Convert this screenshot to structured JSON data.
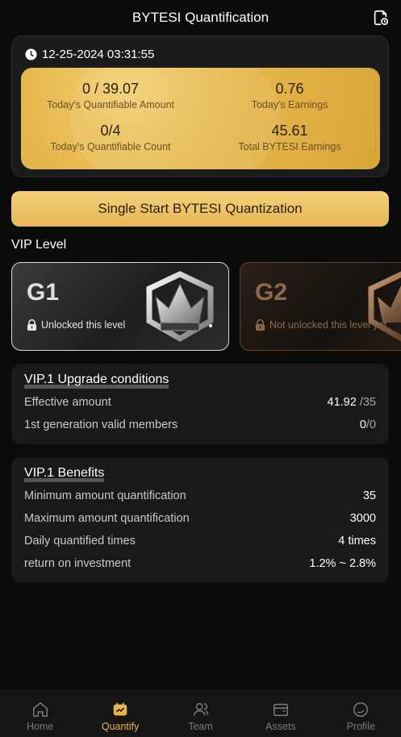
{
  "header": {
    "title": "BYTESI Quantification",
    "icon": "record-history-icon"
  },
  "summary": {
    "datetime": "12-25-2024 03:31:55",
    "quantifiable_amount": {
      "value": "0 / 39.07",
      "label": "Today's Quantifiable Amount"
    },
    "earnings": {
      "value": "0.76",
      "label": "Today's Earnings"
    },
    "quantifiable_count": {
      "value": "0/4",
      "label": "Today's Quantifiable Count"
    },
    "total_earnings": {
      "value": "45.61",
      "label": "Total BYTESI Earnings"
    }
  },
  "start_button": "Single Start BYTESI Quantization",
  "vip": {
    "section_title": "VIP Level",
    "levels": [
      {
        "code": "G1",
        "status": "Unlocked this level"
      },
      {
        "code": "G2",
        "status": "Not unlocked this level yet"
      }
    ]
  },
  "upgrade": {
    "title": "VIP.1 Upgrade conditions",
    "rows": [
      {
        "label": "Effective amount",
        "current": "41.92",
        "target": " /35"
      },
      {
        "label": "1st generation valid members",
        "current": "0",
        "target": "/0"
      }
    ]
  },
  "benefits": {
    "title": "VIP.1 Benefits",
    "rows": [
      {
        "label": "Minimum amount quantification",
        "value": "35"
      },
      {
        "label": "Maximum amount quantification",
        "value": "3000"
      },
      {
        "label": "Daily quantified times",
        "value": "4 times"
      },
      {
        "label": "return on investment",
        "value": "1.2% ~ 2.8%"
      }
    ]
  },
  "tabs": [
    {
      "label": "Home",
      "icon": "home-icon"
    },
    {
      "label": "Quantify",
      "icon": "quantify-icon",
      "active": true
    },
    {
      "label": "Team",
      "icon": "team-icon"
    },
    {
      "label": "Assets",
      "icon": "wallet-icon"
    },
    {
      "label": "Profile",
      "icon": "profile-icon"
    }
  ],
  "colors": {
    "accent": "#e8b54e",
    "gold_panel": "#e6b74c",
    "background": "#0b0b0b"
  }
}
